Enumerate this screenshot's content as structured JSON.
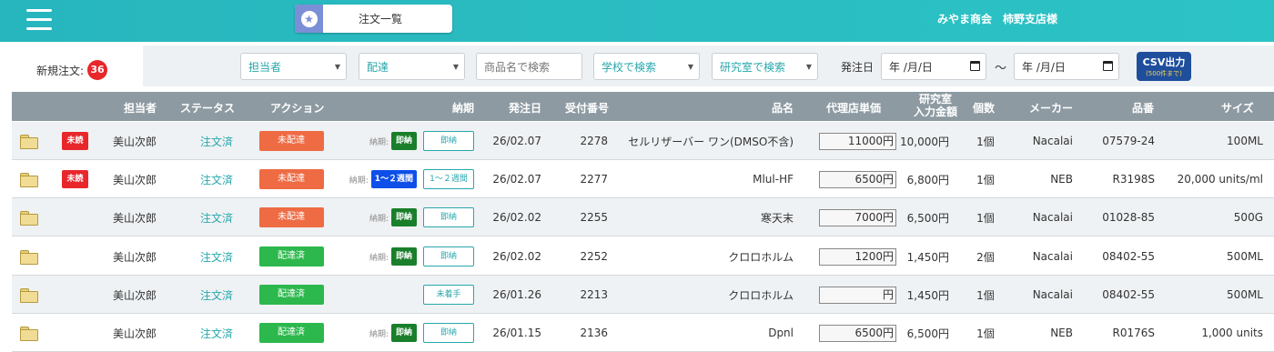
{
  "header": {
    "title": "注文一覧",
    "title_icon": "star-badge-icon",
    "shop": "みやま商会　柿野支店様"
  },
  "filters": {
    "new_orders_label": "新規注文:",
    "new_orders_count": "36",
    "assignee": "担当者",
    "delivery": "配達",
    "product_search_placeholder": "商品名で検索",
    "school": "学校で検索",
    "lab": "研究室で検索",
    "order_date_label": "発注日",
    "date_from": "年 /月/日",
    "tilde": "〜",
    "date_to": "年 /月/日",
    "csv_label": "CSV出力",
    "csv_sub": "(500件まで)"
  },
  "columns": {
    "assignee": "担当者",
    "status": "ステータス",
    "action": "アクション",
    "due": "納期",
    "order_date": "発注日",
    "receipt_no": "受付番号",
    "product": "品名",
    "agent_price": "代理店単価",
    "lab_amount_1": "研究室",
    "lab_amount_2": "入力金額",
    "qty": "個数",
    "maker": "メーカー",
    "part_no": "品番",
    "size": "サイズ"
  },
  "rows": [
    {
      "unread": "未読",
      "assignee": "美山次郎",
      "status": "注文済",
      "action": "未配達",
      "action_color": "orange",
      "due_label": "納期:",
      "due_badge": "即納",
      "due_badge_color": "green",
      "due_button": "即納",
      "order_date": "26/02.07",
      "receipt_no": "2278",
      "product": "セルリザーバー ワン(DMSO不含)",
      "agent_price": "11000円",
      "lab_amount": "10,000円",
      "qty": "1個",
      "maker": "Nacalai",
      "part_no": "07579-24",
      "size": "100ML"
    },
    {
      "unread": "未読",
      "assignee": "美山次郎",
      "status": "注文済",
      "action": "未配達",
      "action_color": "orange",
      "due_label": "納期:",
      "due_badge": "1〜２週間",
      "due_badge_color": "blue",
      "due_button": "1〜２週間",
      "order_date": "26/02.07",
      "receipt_no": "2277",
      "product": "Mlul-HF",
      "agent_price": "6500円",
      "lab_amount": "6,800円",
      "qty": "1個",
      "maker": "NEB",
      "part_no": "R3198S",
      "size": "20,000 units/ml"
    },
    {
      "unread": "",
      "assignee": "美山次郎",
      "status": "注文済",
      "action": "未配達",
      "action_color": "orange",
      "due_label": "納期:",
      "due_badge": "即納",
      "due_badge_color": "green",
      "due_button": "即納",
      "order_date": "26/02.02",
      "receipt_no": "2255",
      "product": "寒天末",
      "agent_price": "7000円",
      "lab_amount": "6,500円",
      "qty": "1個",
      "maker": "Nacalai",
      "part_no": "01028-85",
      "size": "500G"
    },
    {
      "unread": "",
      "assignee": "美山次郎",
      "status": "注文済",
      "action": "配達済",
      "action_color": "green",
      "due_label": "納期:",
      "due_badge": "即納",
      "due_badge_color": "green",
      "due_button": "即納",
      "order_date": "26/02.02",
      "receipt_no": "2252",
      "product": "クロロホルム",
      "agent_price": "1200円",
      "lab_amount": "1,450円",
      "qty": "2個",
      "maker": "Nacalai",
      "part_no": "08402-55",
      "size": "500ML"
    },
    {
      "unread": "",
      "assignee": "美山次郎",
      "status": "注文済",
      "action": "配達済",
      "action_color": "green",
      "due_label": "",
      "due_badge": "",
      "due_badge_color": "",
      "due_button": "未着手",
      "order_date": "26/01.26",
      "receipt_no": "2213",
      "product": "クロロホルム",
      "agent_price": "円",
      "lab_amount": "1,450円",
      "qty": "1個",
      "maker": "Nacalai",
      "part_no": "08402-55",
      "size": "500ML"
    },
    {
      "unread": "",
      "assignee": "美山次郎",
      "status": "注文済",
      "action": "配達済",
      "action_color": "green",
      "due_label": "納期:",
      "due_badge": "即納",
      "due_badge_color": "green",
      "due_button": "即納",
      "order_date": "26/01.15",
      "receipt_no": "2136",
      "product": "Dpnl",
      "agent_price": "6500円",
      "lab_amount": "6,500円",
      "qty": "1個",
      "maker": "NEB",
      "part_no": "R0176S",
      "size": "1,000 units"
    }
  ]
}
